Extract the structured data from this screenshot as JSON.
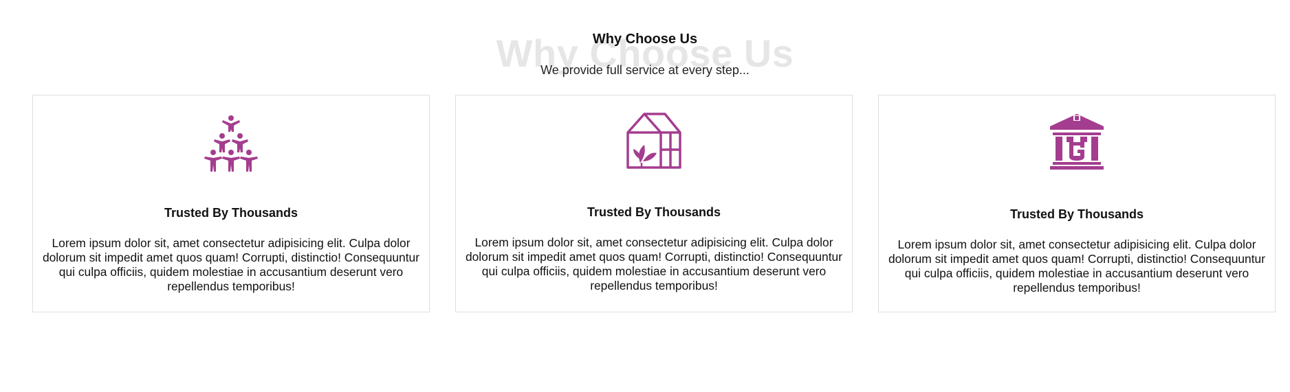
{
  "section": {
    "background_title": "Why Choose Us",
    "title": "Why Choose Us",
    "subtitle": "We provide full service at every step..."
  },
  "colors": {
    "accent": "#a43d8f",
    "card_border": "#dedede",
    "background_title": "#e6e6e6"
  },
  "cards": [
    {
      "icon": "human-pyramid-icon",
      "title": "Trusted By Thousands",
      "text": "Lorem ipsum dolor sit, amet consectetur adipisicing elit. Culpa dolor dolorum sit impedit amet quos quam! Corrupti, distinctio! Consequuntur qui culpa officiis, quidem molestiae in accusantium deserunt vero repellendus temporibus!"
    },
    {
      "icon": "greenhouse-icon",
      "title": "Trusted By Thousands",
      "text": "Lorem ipsum dolor sit, amet consectetur adipisicing elit. Culpa dolor dolorum sit impedit amet quos quam! Corrupti, distinctio! Consequuntur qui culpa officiis, quidem molestiae in accusantium deserunt vero repellendus temporibus!"
    },
    {
      "icon": "bank-building-icon",
      "title": "Trusted By Thousands",
      "text": "Lorem ipsum dolor sit, amet consectetur adipisicing elit. Culpa dolor dolorum sit impedit amet quos quam! Corrupti, distinctio! Consequuntur qui culpa officiis, quidem molestiae in accusantium deserunt vero repellendus temporibus!"
    }
  ]
}
